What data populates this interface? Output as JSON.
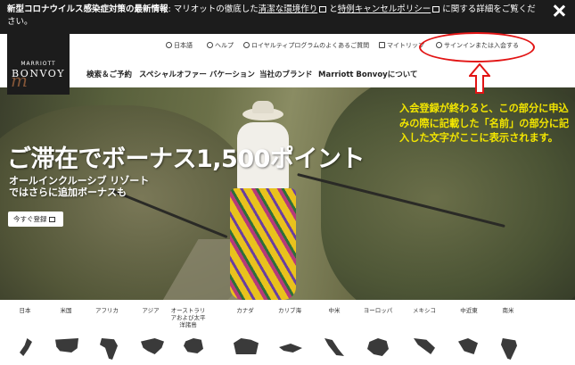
{
  "alert": {
    "bold_text": "新型コロナウイルス感染症対策の最新情報",
    "text_1": ": マリオットの徹底した",
    "link_1": "清潔な環境作り",
    "text_2": "と",
    "link_2": "特例キャンセルポリシー",
    "text_3": "に関する詳細をご覧ください。"
  },
  "logo": {
    "small": "MARRIOTT",
    "big": "BONVOY",
    "script": "m"
  },
  "utility_nav": [
    {
      "label": "日本語",
      "icon": "globe-icon"
    },
    {
      "label": "ヘルプ",
      "icon": "help-icon"
    },
    {
      "label": "ロイヤルティプログラムのよくあるご質問",
      "icon": "info-icon"
    },
    {
      "label": "マイトリップ",
      "icon": "trip-icon"
    },
    {
      "label": "サインインまたは入会する",
      "icon": "user-icon"
    }
  ],
  "main_nav": [
    "検索＆ご予約",
    "スペシャルオファー",
    "バケーション",
    "当社のブランド",
    "Marriott Bonvoyについて"
  ],
  "hero": {
    "title": "ご滞在でボーナス1,500ポイント",
    "subtitle_1": "オールインクルーシブ リゾート",
    "subtitle_2": "ではさらに追加ボーナスも",
    "button": "今すぐ登録"
  },
  "annotation": {
    "text": "入会登録が終わると、この部分に申込みの際に記載した「名前」の部分に記入した文字がここに表示されます。",
    "color": "#f3e600",
    "ellipse_color": "#e21414"
  },
  "regions": [
    "日本",
    "米国",
    "アフリカ",
    "アジア",
    "オーストラリアおよび太平洋諸島",
    "カナダ",
    "カリブ海",
    "中米",
    "ヨーロッパ",
    "メキシコ",
    "中近東",
    "南米"
  ],
  "colors": {
    "dark": "#1c1c1c",
    "accent": "#c87c4a"
  }
}
